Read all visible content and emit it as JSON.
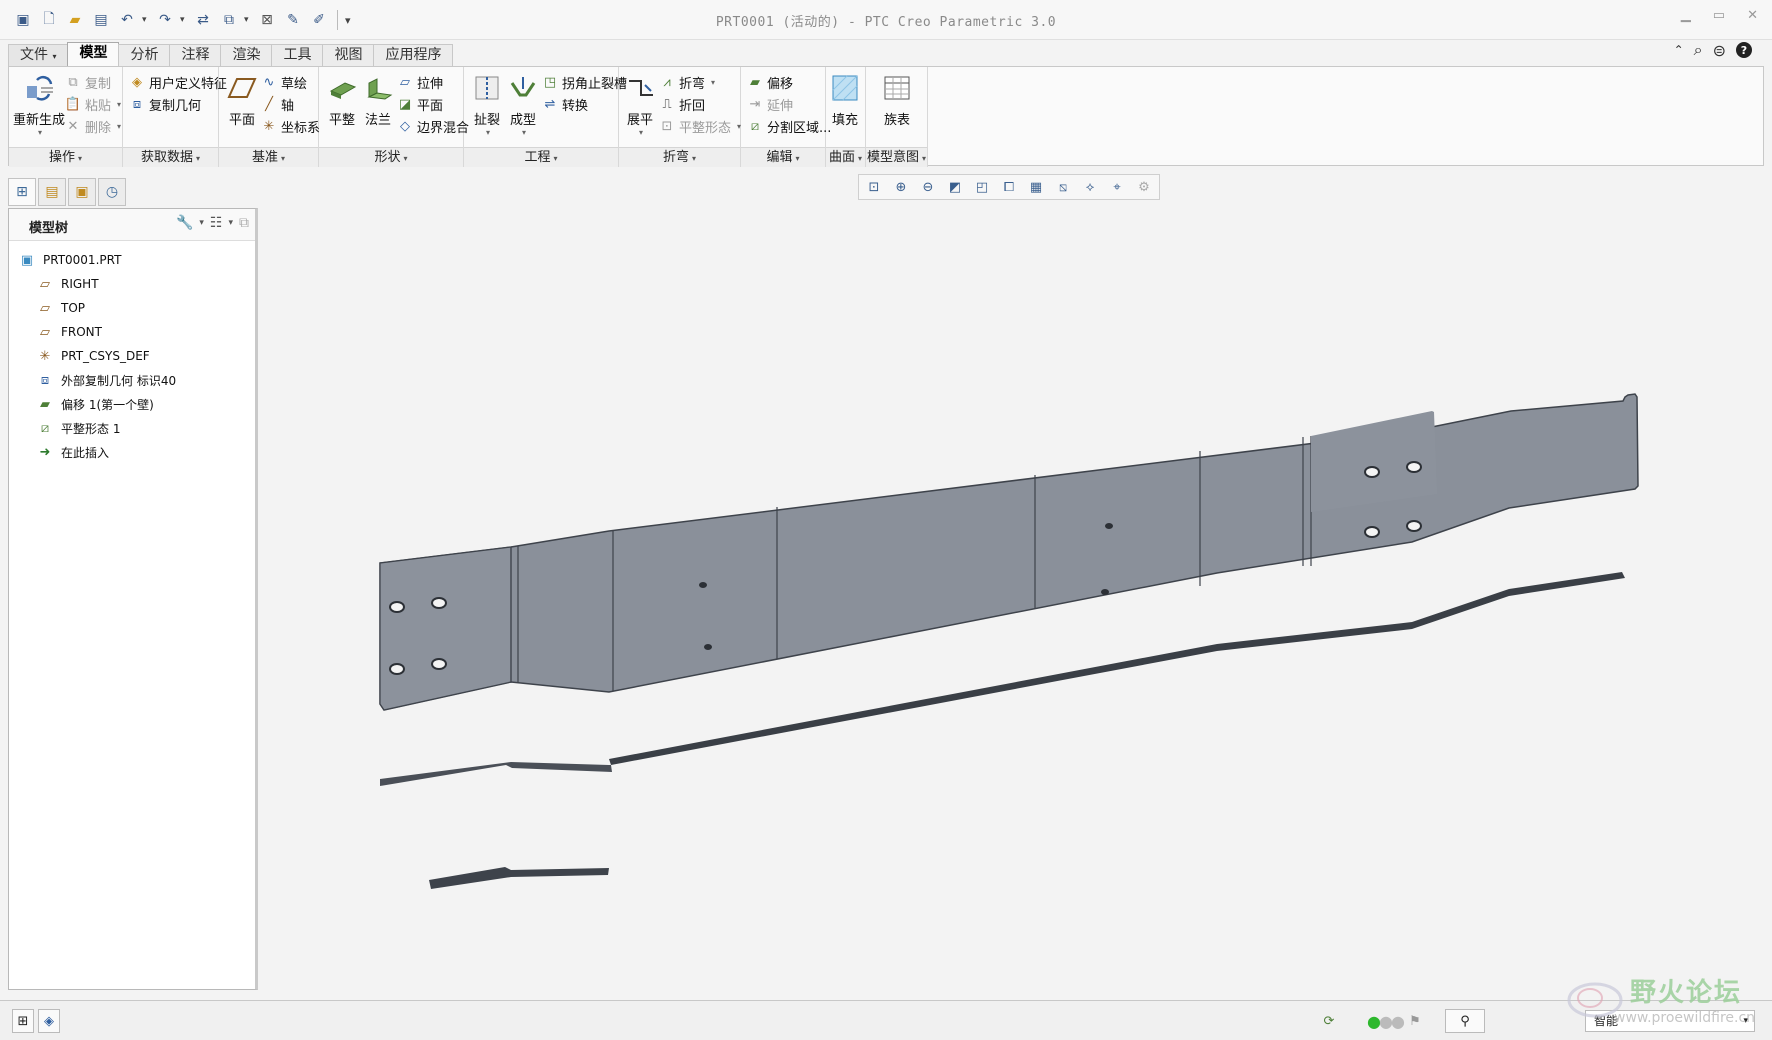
{
  "window": {
    "title": "PRT0001 (活动的) - PTC Creo Parametric 3.0"
  },
  "quick_access": {
    "icons": [
      "window-icon",
      "new-icon",
      "open-icon",
      "save-icon",
      "undo-icon",
      "redo-icon",
      "regenerate-icon",
      "windows-icon",
      "close-window-icon",
      "sketch-icon",
      "setup-icon",
      "customize-icon"
    ]
  },
  "tabs": [
    "文件",
    "模型",
    "分析",
    "注释",
    "渲染",
    "工具",
    "视图",
    "应用程序"
  ],
  "active_tab": "模型",
  "ribbon": {
    "groups": {
      "operations": {
        "label": "操作",
        "regenerate": "重新生成",
        "copy": "复制",
        "paste": "粘贴",
        "delete": "删除"
      },
      "get_data": {
        "label": "获取数据",
        "udf": "用户定义特征",
        "copy_geom": "复制几何"
      },
      "datum": {
        "label": "基准",
        "plane": "平面",
        "sketch": "草绘",
        "axis": "轴",
        "csys": "坐标系"
      },
      "shapes": {
        "label": "形状",
        "flat": "平整",
        "flange": "法兰",
        "extrude": "拉伸",
        "planar": "平面",
        "blend": "边界混合"
      },
      "engineering": {
        "label": "工程",
        "rip": "扯裂",
        "form": "成型",
        "corner_relief": "拐角止裂槽",
        "convert": "转换"
      },
      "bends": {
        "label": "折弯",
        "unbend": "展平",
        "bend": "折弯",
        "bend_back": "折回",
        "flat_state": "平整形态"
      },
      "editing": {
        "label": "编辑",
        "offset": "偏移",
        "extend": "延伸",
        "split": "分割区域..."
      },
      "surfaces": {
        "label": "曲面",
        "fill": "填充"
      },
      "model_intent": {
        "label": "模型意图",
        "family_table": "族表"
      }
    }
  },
  "navigator": {
    "title": "模型树",
    "items": [
      {
        "label": "PRT0001.PRT",
        "icon": "part-icon"
      },
      {
        "label": "RIGHT",
        "icon": "datum-plane-icon"
      },
      {
        "label": "TOP",
        "icon": "datum-plane-icon"
      },
      {
        "label": "FRONT",
        "icon": "datum-plane-icon"
      },
      {
        "label": "PRT_CSYS_DEF",
        "icon": "csys-icon"
      },
      {
        "label": "外部复制几何 标识40",
        "icon": "copy-geom-icon"
      },
      {
        "label": "偏移 1(第一个壁)",
        "icon": "offset-wall-icon"
      },
      {
        "label": "平整形态 1",
        "icon": "flat-state-icon"
      },
      {
        "label": "在此插入",
        "icon": "insert-here-icon"
      }
    ]
  },
  "view_toolbar": [
    "refit-icon",
    "zoom-in-icon",
    "zoom-out-icon",
    "repaint-icon",
    "display-style-icon",
    "saved-views-icon",
    "view-manager-icon",
    "plane-display-icon",
    "axis-display-icon",
    "point-display-icon",
    "csys-display-icon"
  ],
  "status": {
    "filter": "智能"
  },
  "watermark": {
    "text": "野火论坛",
    "url": "www.proewildfire.cn"
  },
  "colors": {
    "part_face": "#8a909a",
    "part_edge": "#3e434b",
    "accent": "#2f5fa0"
  }
}
